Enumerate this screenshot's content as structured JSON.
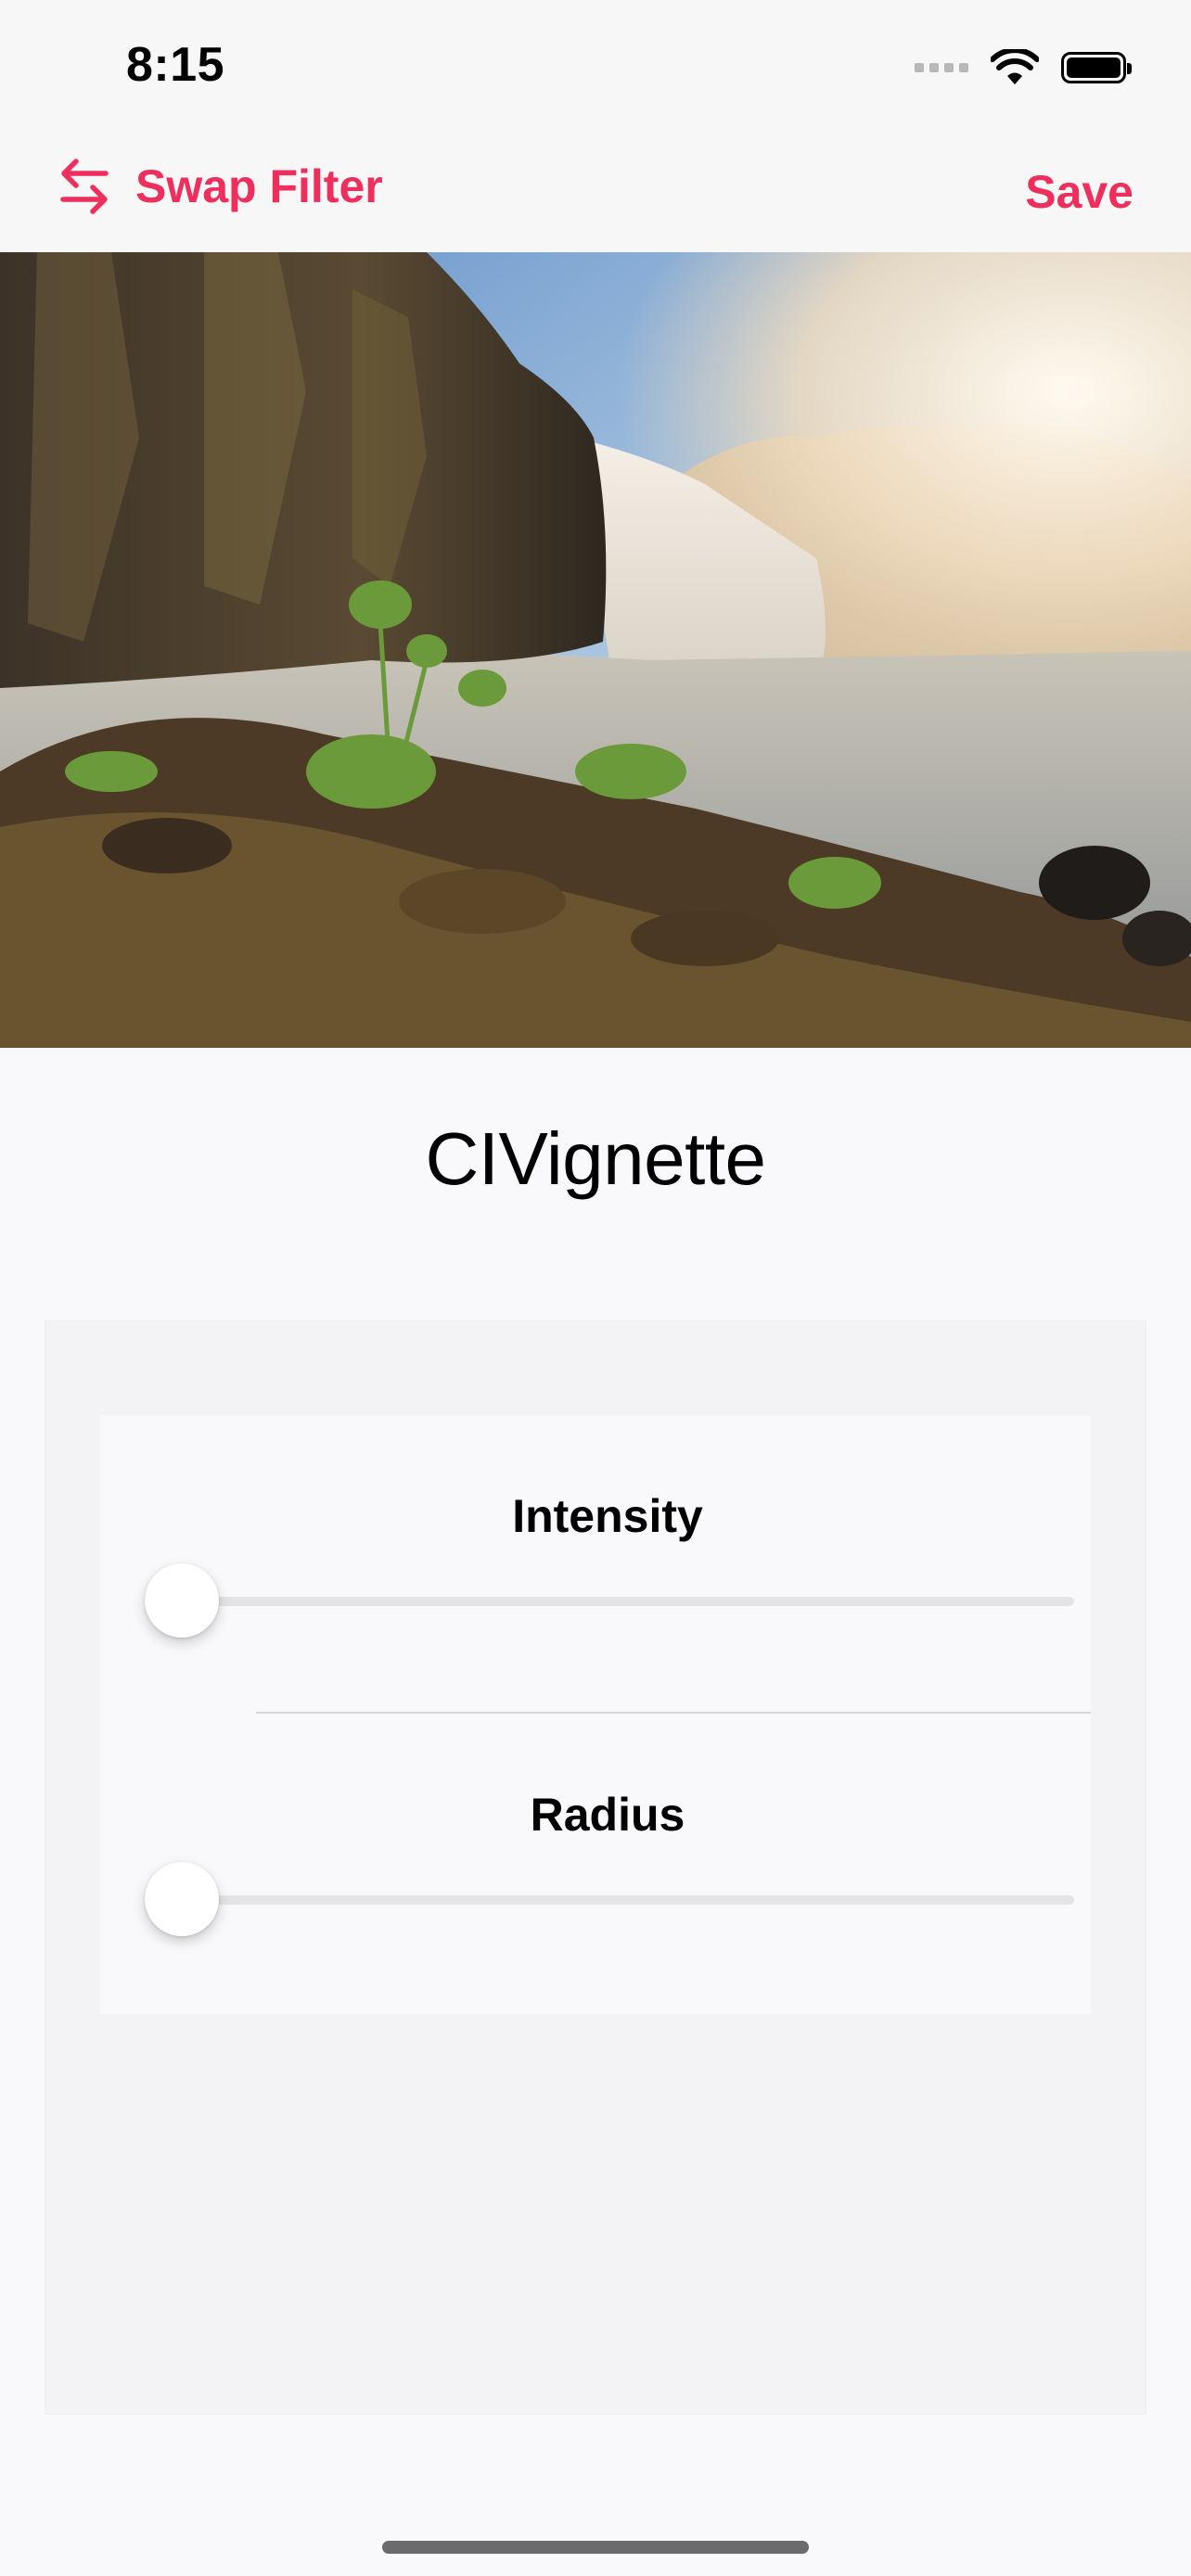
{
  "status_bar": {
    "time": "8:15",
    "icons": [
      "cellular-signal-icon",
      "wifi-icon",
      "battery-icon"
    ]
  },
  "nav": {
    "swap_label": "Swap Filter",
    "save_label": "Save",
    "accent_color": "#EE2F5D"
  },
  "photo": {
    "description_icon": "waterfall-photo"
  },
  "filter": {
    "name": "CIVignette"
  },
  "controls": {
    "intensity": {
      "label": "Intensity",
      "value": 0.0
    },
    "radius": {
      "label": "Radius",
      "value": 0.0
    }
  }
}
